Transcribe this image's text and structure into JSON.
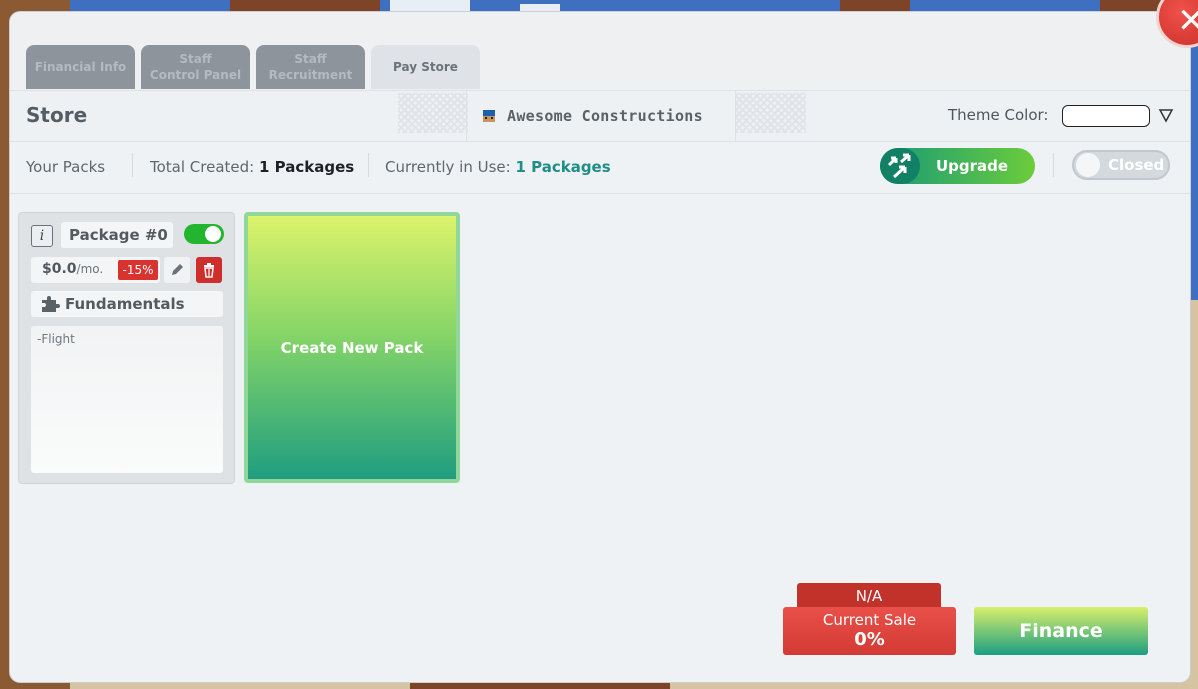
{
  "tabs": [
    {
      "label": "Financial Info"
    },
    {
      "label": "Staff\nControl Panel"
    },
    {
      "label": "Staff\nRecruitment"
    },
    {
      "label": "Pay Store"
    }
  ],
  "header": {
    "title": "Store",
    "company_name": "Awesome Constructions",
    "theme_label": "Theme Color:",
    "theme_color": "#ffffff"
  },
  "packs_bar": {
    "your_packs": "Your Packs",
    "total_created_label": "Total Created:",
    "total_created_value": "1 Packages",
    "in_use_label": "Currently in Use:",
    "in_use_value": "1 Packages",
    "upgrade_label": "Upgrade",
    "closed_label": "Closed"
  },
  "package": {
    "name": "Package #0",
    "enabled": true,
    "price": "$0.0",
    "price_unit": "/mo.",
    "discount": "-15%",
    "category": "Fundamentals",
    "features": [
      "-Flight"
    ]
  },
  "create_pack_label": "Create New Pack",
  "sale": {
    "na_label": "N/A",
    "current_sale_label": "Current Sale",
    "current_sale_value": "0%"
  },
  "finance_label": "Finance",
  "colors": {
    "accent_green": "#22b52d",
    "danger_red": "#d93330",
    "teal": "#1f8e86"
  }
}
